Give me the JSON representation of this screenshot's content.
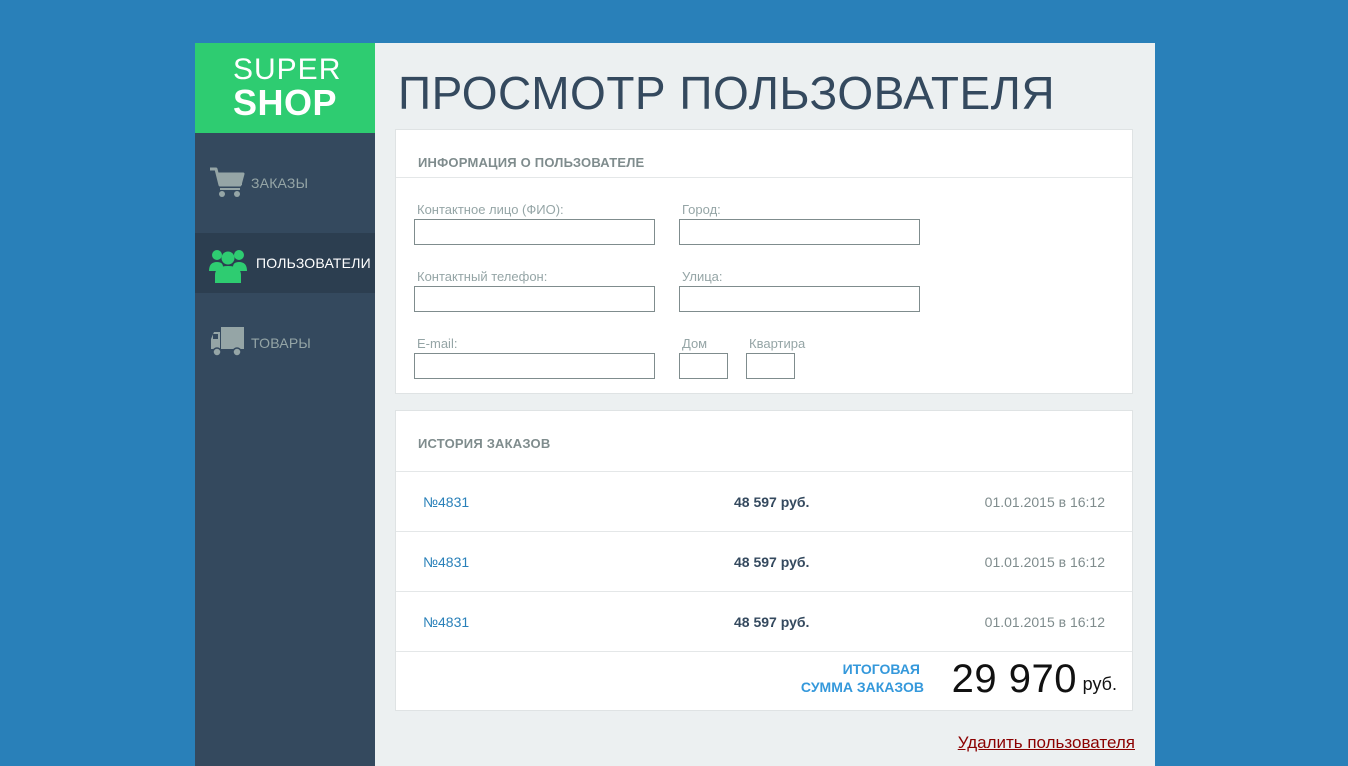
{
  "logo": {
    "line1": "SUPER",
    "line2": "SHOP"
  },
  "sidebar": {
    "items": [
      {
        "label": "ЗАКАЗЫ",
        "icon": "cart-icon",
        "active": false
      },
      {
        "label": "ПОЛЬЗОВАТЕЛИ",
        "icon": "users-icon",
        "active": true
      },
      {
        "label": "ТОВАРЫ",
        "icon": "truck-icon",
        "active": false
      }
    ]
  },
  "page_title": "ПРОСМОТР ПОЛЬЗОВАТЕЛЯ",
  "user_info": {
    "heading": "ИНФОРМАЦИЯ О ПОЛЬЗОВАТЕЛЕ",
    "fields": {
      "contact_name": {
        "label": "Контактное лицо (ФИО):",
        "value": ""
      },
      "city": {
        "label": "Город:",
        "value": ""
      },
      "phone": {
        "label": "Контактный телефон:",
        "value": ""
      },
      "street": {
        "label": "Улица:",
        "value": ""
      },
      "email": {
        "label": "E-mail:",
        "value": ""
      },
      "house": {
        "label": "Дом",
        "value": ""
      },
      "apartment": {
        "label": "Квартира",
        "value": ""
      }
    }
  },
  "orders": {
    "heading": "ИСТОРИЯ ЗАКАЗОВ",
    "rows": [
      {
        "number": "№4831",
        "sum": "48 597 руб.",
        "date": "01.01.2015 в 16:12"
      },
      {
        "number": "№4831",
        "sum": "48 597 руб.",
        "date": "01.01.2015 в 16:12"
      },
      {
        "number": "№4831",
        "sum": "48 597 руб.",
        "date": "01.01.2015 в 16:12"
      }
    ],
    "total_label_line1": "ИТОГОВАЯ",
    "total_label_line2": "СУММА ЗАКАЗОВ",
    "total_value": "29 970",
    "total_unit": "руб."
  },
  "delete_link": "Удалить пользователя",
  "colors": {
    "background": "#2980b9",
    "sidebar": "#34495e",
    "logo": "#2ecc71",
    "accent": "#3498db",
    "delete": "#8b0000"
  }
}
